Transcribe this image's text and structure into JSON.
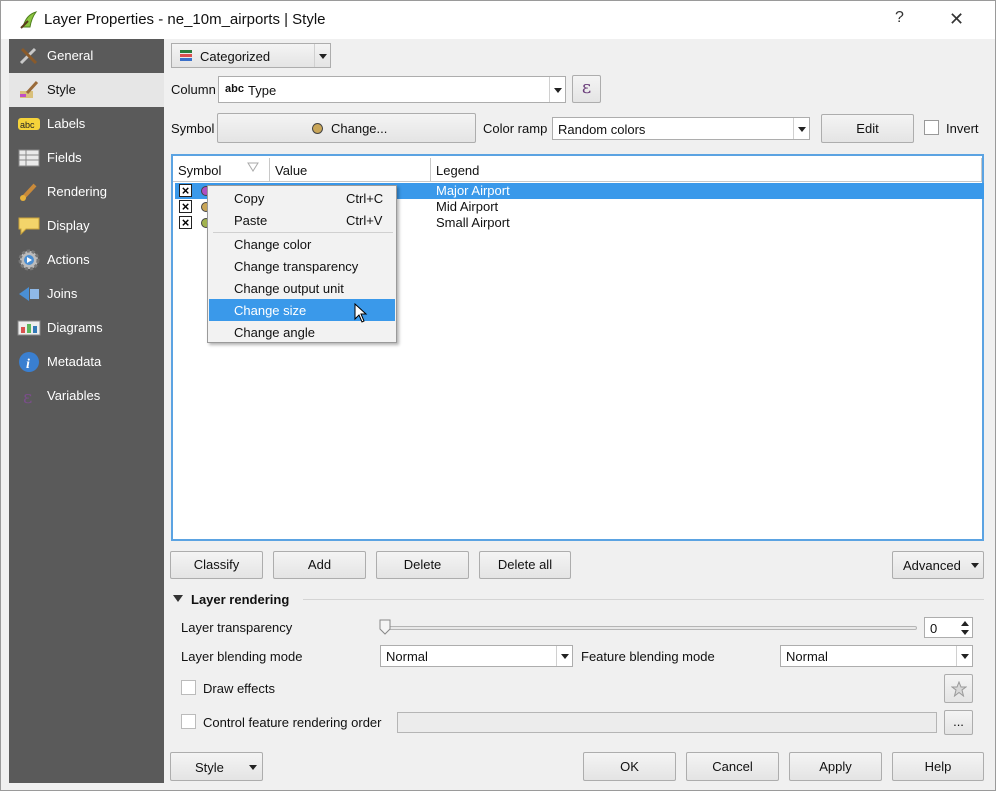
{
  "window": {
    "title": "Layer Properties - ne_10m_airports | Style",
    "help_label": "?",
    "close_label": "✕"
  },
  "sidebar": {
    "items": [
      {
        "label": "General",
        "icon": "tools-icon"
      },
      {
        "label": "Style",
        "icon": "paintbrush-icon"
      },
      {
        "label": "Labels",
        "icon": "abc-label-icon"
      },
      {
        "label": "Fields",
        "icon": "table-icon"
      },
      {
        "label": "Rendering",
        "icon": "brush-icon"
      },
      {
        "label": "Display",
        "icon": "speech-bubble-icon"
      },
      {
        "label": "Actions",
        "icon": "gear-play-icon"
      },
      {
        "label": "Joins",
        "icon": "join-arrow-icon"
      },
      {
        "label": "Diagrams",
        "icon": "chart-icon"
      },
      {
        "label": "Metadata",
        "icon": "info-icon"
      },
      {
        "label": "Variables",
        "icon": "epsilon-icon"
      }
    ],
    "selected": "Style"
  },
  "renderer": {
    "type_value": "Categorized"
  },
  "column": {
    "label": "Column",
    "type_prefix": "abc",
    "value": "Type",
    "expression_symbol": "ε"
  },
  "symbol": {
    "label": "Symbol",
    "change_label": "Change...",
    "color_ramp_label": "Color ramp",
    "color_ramp_value": "Random colors",
    "edit_label": "Edit",
    "invert_label": "Invert"
  },
  "table": {
    "headers": [
      "Symbol",
      "Value",
      "Legend"
    ],
    "rows": [
      {
        "legend": "Major Airport",
        "color": "#b04fc2",
        "selected": true
      },
      {
        "legend": "Mid Airport",
        "color": "#c9a659",
        "selected": false
      },
      {
        "legend": "Small Airport",
        "color": "#a2b34f",
        "selected": false
      }
    ]
  },
  "context_menu": {
    "items": [
      {
        "label": "Copy",
        "shortcut": "Ctrl+C"
      },
      {
        "label": "Paste",
        "shortcut": "Ctrl+V"
      },
      {
        "label": "Change color",
        "shortcut": ""
      },
      {
        "label": "Change transparency",
        "shortcut": ""
      },
      {
        "label": "Change output unit",
        "shortcut": ""
      },
      {
        "label": "Change size",
        "shortcut": ""
      },
      {
        "label": "Change angle",
        "shortcut": ""
      }
    ],
    "highlighted": "Change size"
  },
  "actions": {
    "classify": "Classify",
    "add": "Add",
    "delete": "Delete",
    "delete_all": "Delete all",
    "advanced": "Advanced"
  },
  "layer_rendering": {
    "title": "Layer rendering",
    "transparency_label": "Layer transparency",
    "transparency_value": "0",
    "blending_label": "Layer blending mode",
    "blending_value": "Normal",
    "feature_blending_label": "Feature blending mode",
    "feature_blending_value": "Normal",
    "draw_effects_label": "Draw effects",
    "control_order_label": "Control feature rendering order",
    "ellipsis_label": "..."
  },
  "footer": {
    "style": "Style",
    "ok": "OK",
    "cancel": "Cancel",
    "apply": "Apply",
    "help": "Help"
  }
}
